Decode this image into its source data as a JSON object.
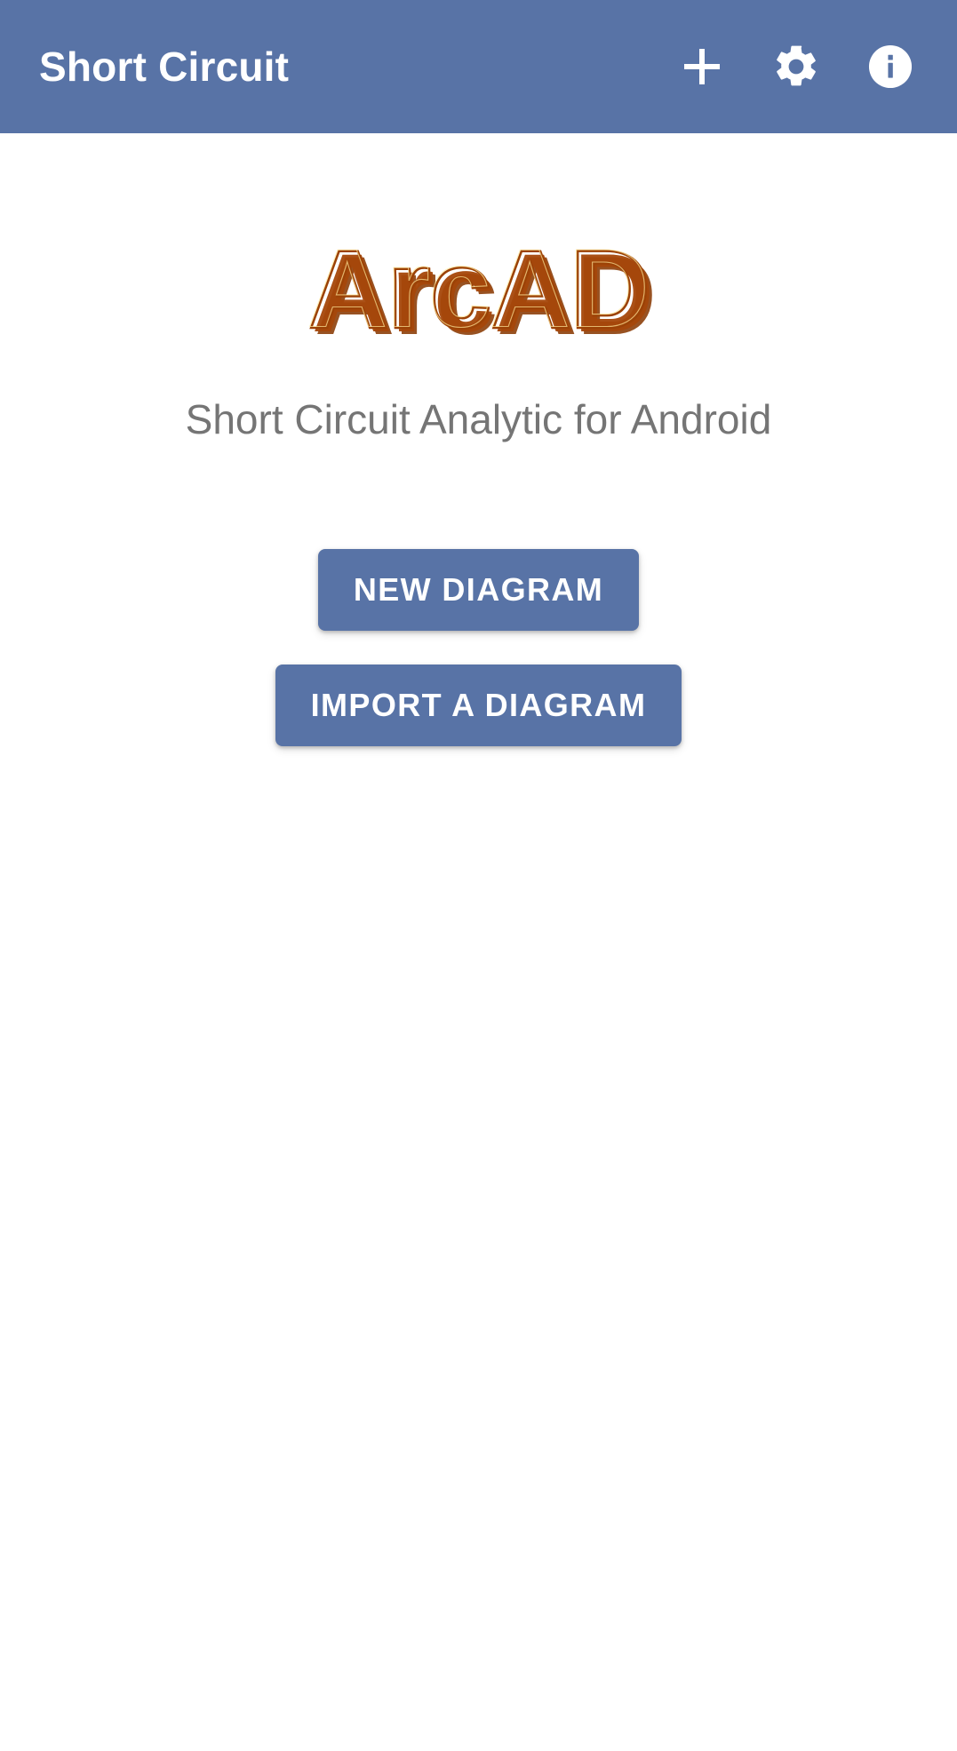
{
  "app": {
    "title": "Short Circuit",
    "accent_color": "#5873a6",
    "background_color": "#ffffff"
  },
  "appbar": {
    "title": "Short Circuit",
    "actions": [
      {
        "name": "add-icon",
        "label": "+",
        "tooltip": "Add"
      },
      {
        "name": "gear-icon",
        "label": "Settings",
        "tooltip": "Settings"
      },
      {
        "name": "info-icon",
        "label": "Info",
        "tooltip": "About"
      }
    ]
  },
  "main": {
    "logo": {
      "text": "ArcAD",
      "style": "fire-texture-beveled",
      "colors": {
        "flame_light": "#ffe14a",
        "flame_mid": "#ff8c17",
        "flame_deep": "#e35c06",
        "bevel_shadow": "#8a3b04"
      }
    },
    "subtitle": "Short Circuit Analytic for Android",
    "buttons": [
      {
        "name": "new-diagram-button",
        "label": "NEW DIAGRAM"
      },
      {
        "name": "import-diagram-button",
        "label": "IMPORT A DIAGRAM"
      }
    ]
  }
}
